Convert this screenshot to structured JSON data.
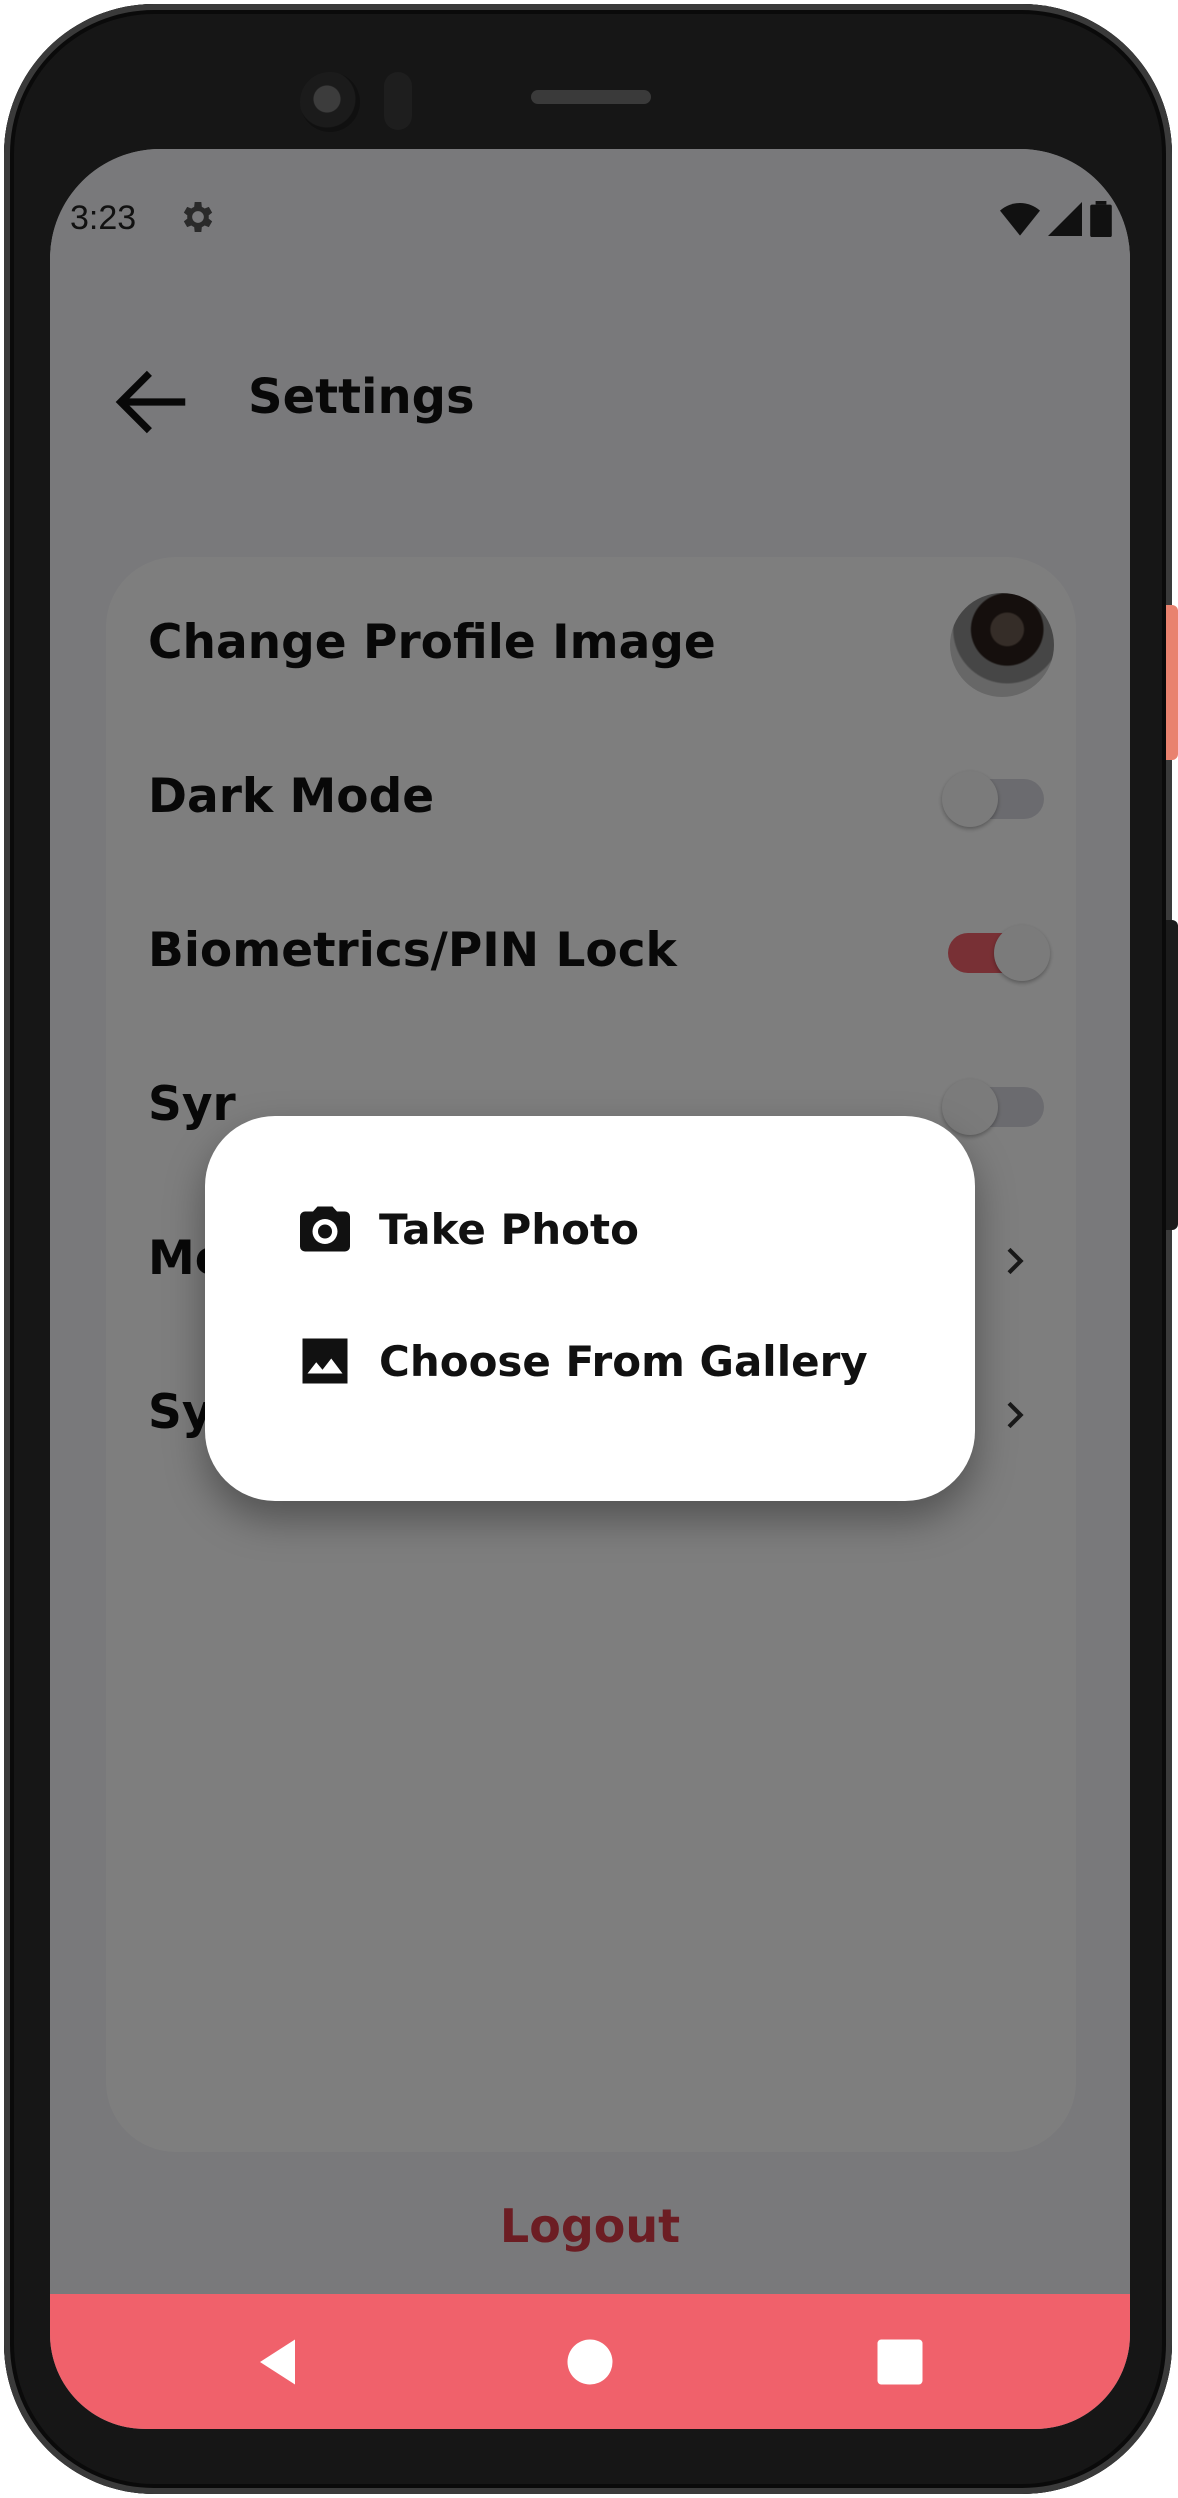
{
  "status_bar": {
    "time": "3:23",
    "icons": [
      "gear-icon",
      "wifi-icon",
      "signal-icon",
      "battery-icon"
    ]
  },
  "header": {
    "title": "Settings",
    "back_icon": "arrow-left-icon"
  },
  "settings": {
    "change_profile_image": "Change Profile Image",
    "dark_mode": "Dark Mode",
    "dark_mode_on": false,
    "biometrics_lock": "Biometrics/PIN Lock",
    "biometrics_lock_on": true,
    "row4_partial": "Syr",
    "row4_on": false,
    "row5_partial": "Mo",
    "row6_partial": "Syr"
  },
  "logout_label": "Logout",
  "dialog": {
    "take_photo": "Take Photo",
    "take_photo_icon": "camera-icon",
    "choose_gallery": "Choose From Gallery",
    "choose_gallery_icon": "image-icon"
  },
  "colors": {
    "accent": "#f0616b",
    "logout": "#d83a46"
  }
}
